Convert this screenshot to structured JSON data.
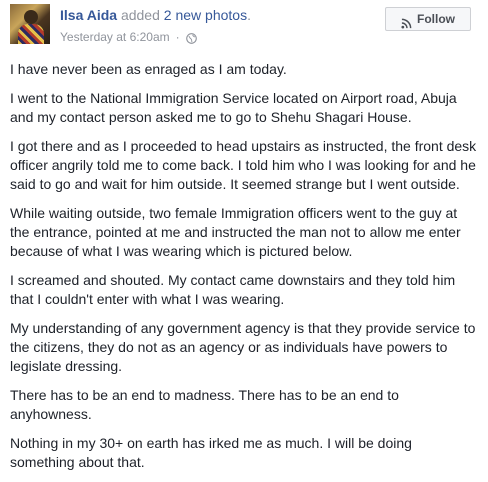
{
  "post": {
    "author": "Ilsa Aida",
    "action_prefix": "added",
    "action_link": "2 new photos",
    "action_suffix": ".",
    "timestamp": "Yesterday at 6:20am",
    "separator": "·",
    "privacy_icon": "globe-icon",
    "follow_label": "Follow",
    "follow_icon": "rss-icon",
    "paragraphs": [
      "I have never been as enraged as I am today.",
      "I went to the National Immigration Service located on Airport road, Abuja and my contact person asked me to go to Shehu Shagari House.",
      "I got there and as I proceeded to head upstairs as instructed, the front desk officer angrily told me to come back. I told him who I was looking for and he said to go and wait for him outside. It seemed strange but I went outside.",
      "While waiting outside, two female Immigration officers went to the guy at the entrance, pointed at me and instructed the man not to allow me enter because of what I was wearing which is pictured below.",
      "I screamed and shouted. My contact came downstairs and they told him that I couldn't enter with what I was wearing.",
      "My understanding of any government agency is that they provide service to the citizens, they do not as an agency or as individuals have powers to legislate dressing.",
      "There has to be an end to madness. There has to be an end to anyhowness.",
      "Nothing in my 30+ on earth has irked me as much. I will be doing something about that."
    ]
  },
  "colors": {
    "link": "#365899",
    "meta": "#90949c",
    "text": "#1d2129",
    "button_bg": "#f6f7f9",
    "button_border": "#ced0d4"
  }
}
